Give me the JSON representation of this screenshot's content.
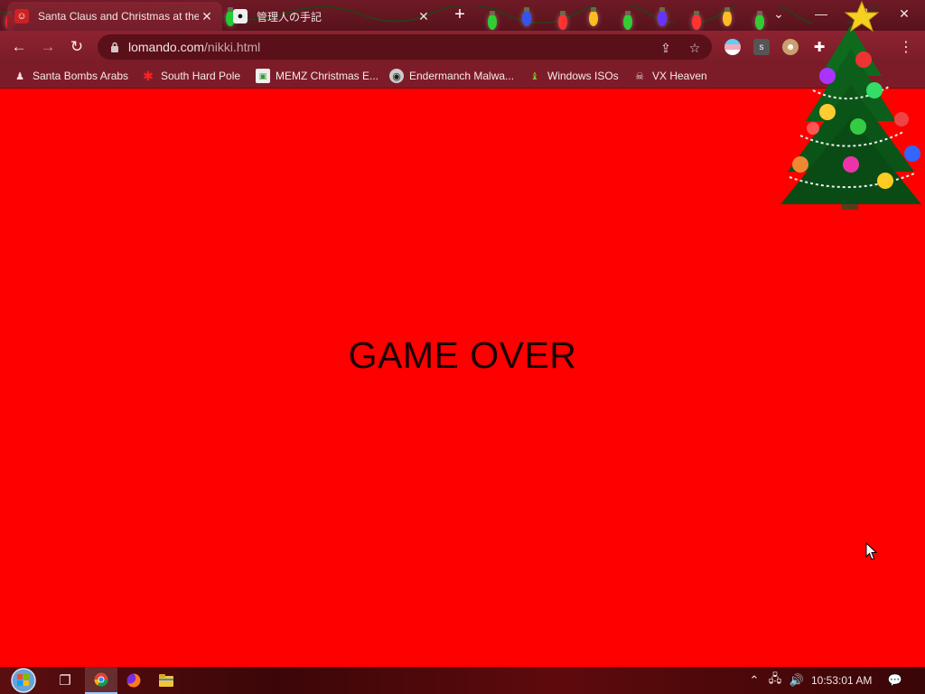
{
  "browser": {
    "tabs": [
      {
        "title": "Santa Claus and Christmas at the",
        "active": true,
        "favicon": "santa-favicon"
      },
      {
        "title": "管理人の手記",
        "active": false,
        "favicon": "panda-favicon"
      }
    ],
    "url_host": "lomando.com",
    "url_path": "/nikki.html",
    "bookmarks": [
      {
        "label": "Santa Bombs Arabs",
        "icon": "santa-bookmark-icon"
      },
      {
        "label": "South Hard Pole",
        "icon": "red-snowflake-icon"
      },
      {
        "label": "MEMZ Christmas E...",
        "icon": "memz-icon"
      },
      {
        "label": "Endermanch Malwa...",
        "icon": "raccoon-icon"
      },
      {
        "label": "Windows ISOs",
        "icon": "green-figure-icon"
      },
      {
        "label": "VX Heaven",
        "icon": "vx-heaven-icon"
      }
    ]
  },
  "page": {
    "message": "GAME OVER",
    "background": "#ff0000"
  },
  "taskbar": {
    "clock": "10:53:01 AM"
  },
  "colors": {
    "theme": "#7d1c29",
    "page": "#ff0000",
    "text": "#1a0000"
  }
}
